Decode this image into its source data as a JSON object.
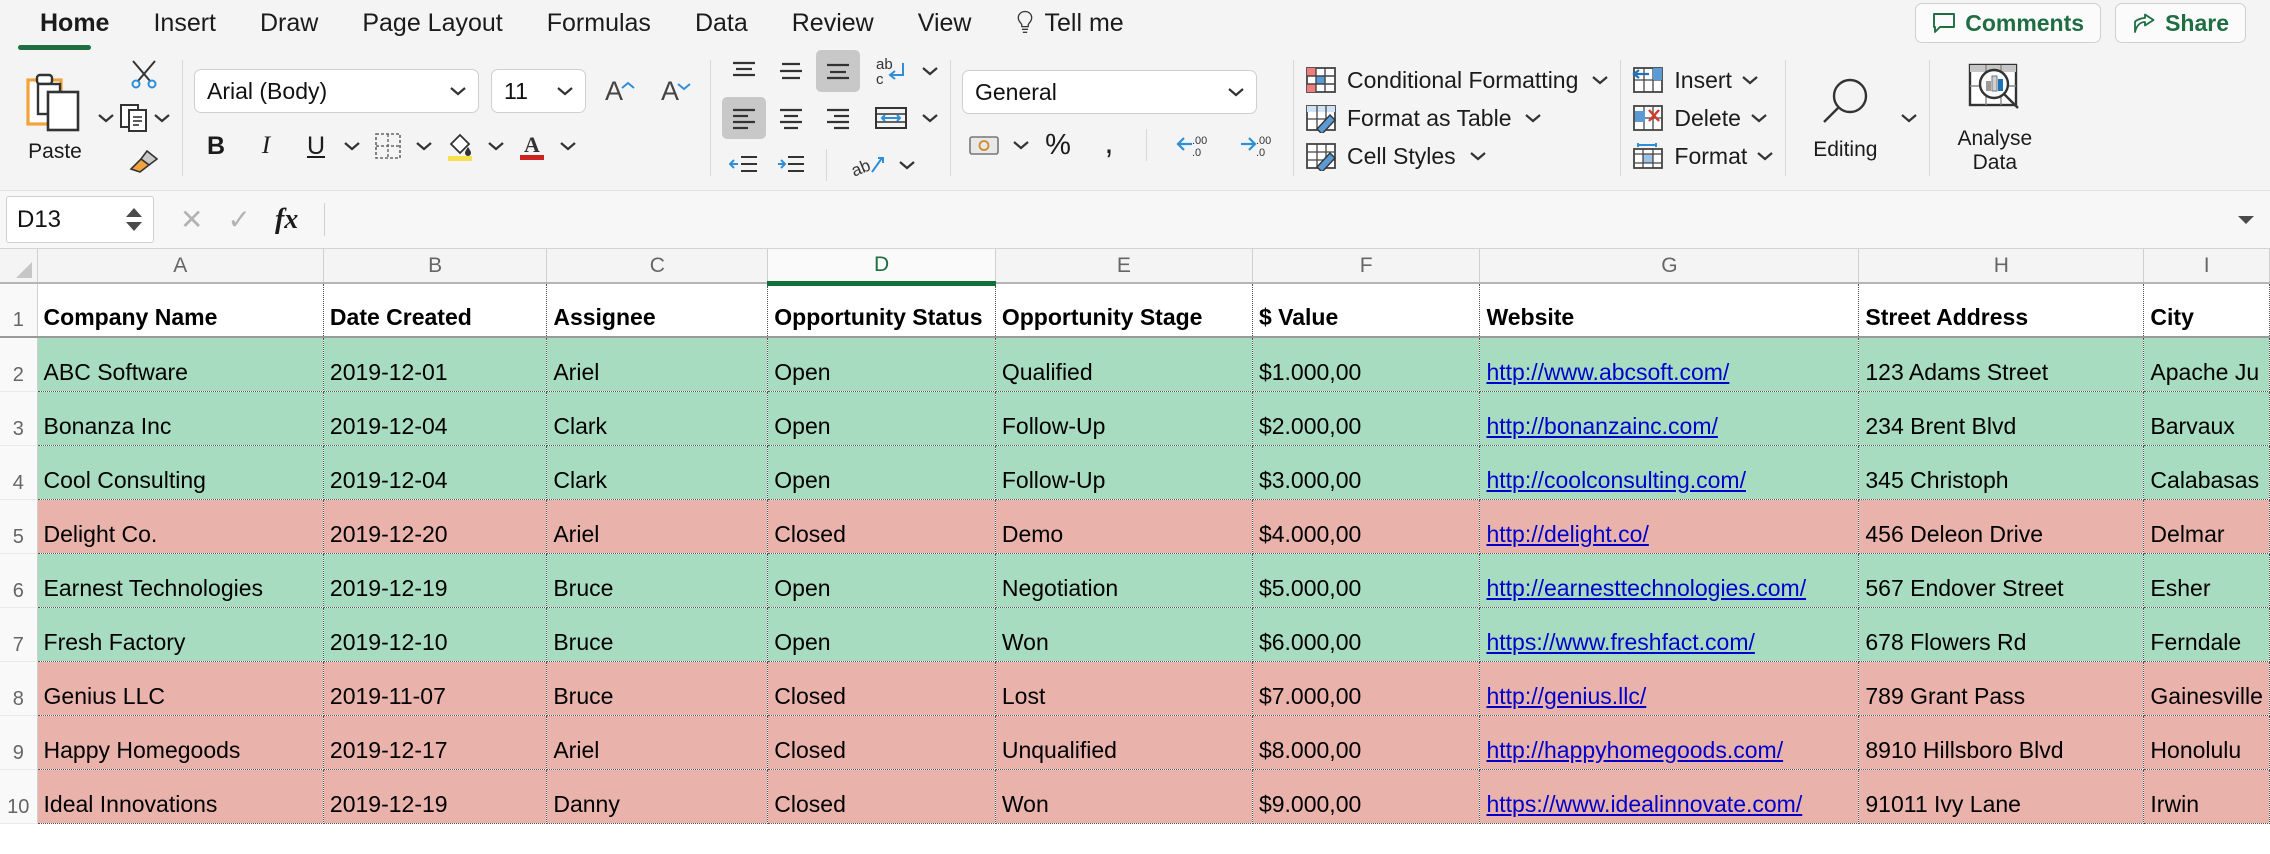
{
  "tabs": [
    {
      "label": "Home",
      "active": true
    },
    {
      "label": "Insert",
      "active": false
    },
    {
      "label": "Draw",
      "active": false
    },
    {
      "label": "Page Layout",
      "active": false
    },
    {
      "label": "Formulas",
      "active": false
    },
    {
      "label": "Data",
      "active": false
    },
    {
      "label": "Review",
      "active": false
    },
    {
      "label": "View",
      "active": false
    }
  ],
  "tellme": {
    "label": "Tell me",
    "icon": "lightbulb-icon"
  },
  "header_actions": {
    "comments": {
      "label": "Comments",
      "icon": "comment-bubble-icon"
    },
    "share": {
      "label": "Share",
      "icon": "share-arrow-icon"
    }
  },
  "ribbon": {
    "clipboard": {
      "paste_label": "Paste",
      "cut_icon": "scissors-icon",
      "copy_icon": "copy-icon",
      "format_painter_icon": "paintbrush-icon"
    },
    "font": {
      "family_value": "Arial (Body)",
      "size_value": "11",
      "grow_font_label": "A",
      "shrink_font_label": "A",
      "bold_label": "B",
      "italic_label": "I",
      "underline_label": "U",
      "borders_icon": "borders-icon",
      "fill_color_icon": "fill-color-icon",
      "font_color_label": "A"
    },
    "alignment": {
      "top_align_icon": "align-top-icon",
      "middle_align_icon": "align-middle-icon",
      "bottom_align_icon": "align-bottom-icon",
      "wrap_text_icon": "wrap-text-icon",
      "align_left_icon": "align-left-icon",
      "align_center_icon": "align-center-icon",
      "align_right_icon": "align-right-icon",
      "merge_cells_icon": "merge-cells-icon",
      "decrease_indent_icon": "decrease-indent-icon",
      "increase_indent_icon": "increase-indent-icon",
      "orientation_icon": "text-orientation-icon"
    },
    "number": {
      "format_value": "General",
      "accounting_icon": "accounting-format-icon",
      "percent_label": "%",
      "comma_label": ",",
      "decrease_decimal_label": ".00",
      "increase_decimal_label": ".00"
    },
    "styles": [
      {
        "label": "Conditional Formatting",
        "icon": "conditional-formatting-icon"
      },
      {
        "label": "Format as Table",
        "icon": "format-as-table-icon"
      },
      {
        "label": "Cell Styles",
        "icon": "cell-styles-icon"
      }
    ],
    "cells": [
      {
        "label": "Insert",
        "icon": "insert-cells-icon"
      },
      {
        "label": "Delete",
        "icon": "delete-cells-icon"
      },
      {
        "label": "Format",
        "icon": "format-cells-icon"
      }
    ],
    "editing": {
      "label": "Editing",
      "icon": "magnifier-icon"
    },
    "analyse": {
      "label_line1": "Analyse",
      "label_line2": "Data",
      "icon": "analyse-data-icon"
    }
  },
  "formula_bar": {
    "name_box_value": "D13",
    "cancel_icon": "cancel-x-icon",
    "enter_icon": "confirm-check-icon",
    "function_icon": "fx-icon",
    "formula_value": "",
    "expand_icon": "chevron-down-icon"
  },
  "sheet": {
    "selected_cell": "D13",
    "selected_column": "D",
    "column_letters": [
      "A",
      "B",
      "C",
      "D",
      "E",
      "F",
      "G",
      "H",
      "I"
    ],
    "row_numbers": [
      "1",
      "2",
      "3",
      "4",
      "5",
      "6",
      "7",
      "8",
      "9",
      "10"
    ],
    "headers": [
      "Company Name",
      "Date Created",
      "Assignee",
      "Opportunity Status",
      "Opportunity Stage",
      "$ Value",
      "Website",
      "Street Address",
      "City"
    ],
    "rows": [
      {
        "fill": "green",
        "cells": [
          "ABC Software",
          "2019-12-01",
          "Ariel",
          "Open",
          "Qualified",
          "$1.000,00",
          "http://www.abcsoft.com/",
          "123 Adams Street",
          "Apache Ju"
        ]
      },
      {
        "fill": "green",
        "cells": [
          "Bonanza Inc",
          "2019-12-04",
          "Clark",
          "Open",
          "Follow-Up",
          "$2.000,00",
          "http://bonanzainc.com/",
          "234 Brent Blvd",
          "Barvaux"
        ]
      },
      {
        "fill": "green",
        "cells": [
          "Cool Consulting",
          "2019-12-04",
          "Clark",
          "Open",
          "Follow-Up",
          "$3.000,00",
          "http://coolconsulting.com/",
          "345 Christoph",
          "Calabasas"
        ]
      },
      {
        "fill": "red",
        "cells": [
          "Delight Co.",
          "2019-12-20",
          "Ariel",
          "Closed",
          "Demo",
          "$4.000,00",
          "http://delight.co/",
          "456 Deleon Drive",
          "Delmar"
        ]
      },
      {
        "fill": "green",
        "cells": [
          "Earnest Technologies",
          "2019-12-19",
          "Bruce",
          "Open",
          "Negotiation",
          "$5.000,00",
          "http://earnesttechnologies.com/",
          "567 Endover Street",
          "Esher"
        ]
      },
      {
        "fill": "green",
        "cells": [
          "Fresh Factory",
          "2019-12-10",
          "Bruce",
          "Open",
          "Won",
          "$6.000,00",
          "https://www.freshfact.com/",
          "678 Flowers Rd",
          "Ferndale"
        ]
      },
      {
        "fill": "red",
        "cells": [
          "Genius LLC",
          "2019-11-07",
          "Bruce",
          "Closed",
          "Lost",
          "$7.000,00",
          "http://genius.llc/",
          "789 Grant Pass",
          "Gainesville"
        ]
      },
      {
        "fill": "red",
        "cells": [
          "Happy Homegoods",
          "2019-12-17",
          "Ariel",
          "Closed",
          "Unqualified",
          "$8.000,00",
          "http://happyhomegoods.com/",
          "8910 Hillsboro Blvd",
          "Honolulu"
        ]
      },
      {
        "fill": "red",
        "cells": [
          "Ideal Innovations",
          "2019-12-19",
          "Danny",
          "Closed",
          "Won",
          "$9.000,00",
          "https://www.idealinnovate.com/",
          "91011 Ivy Lane",
          "Irwin"
        ]
      }
    ]
  },
  "colors": {
    "accent_green": "#1e6e42",
    "fill_green": "#a8dcc0",
    "fill_red": "#e9b3ac",
    "link_blue": "#0000cc"
  }
}
